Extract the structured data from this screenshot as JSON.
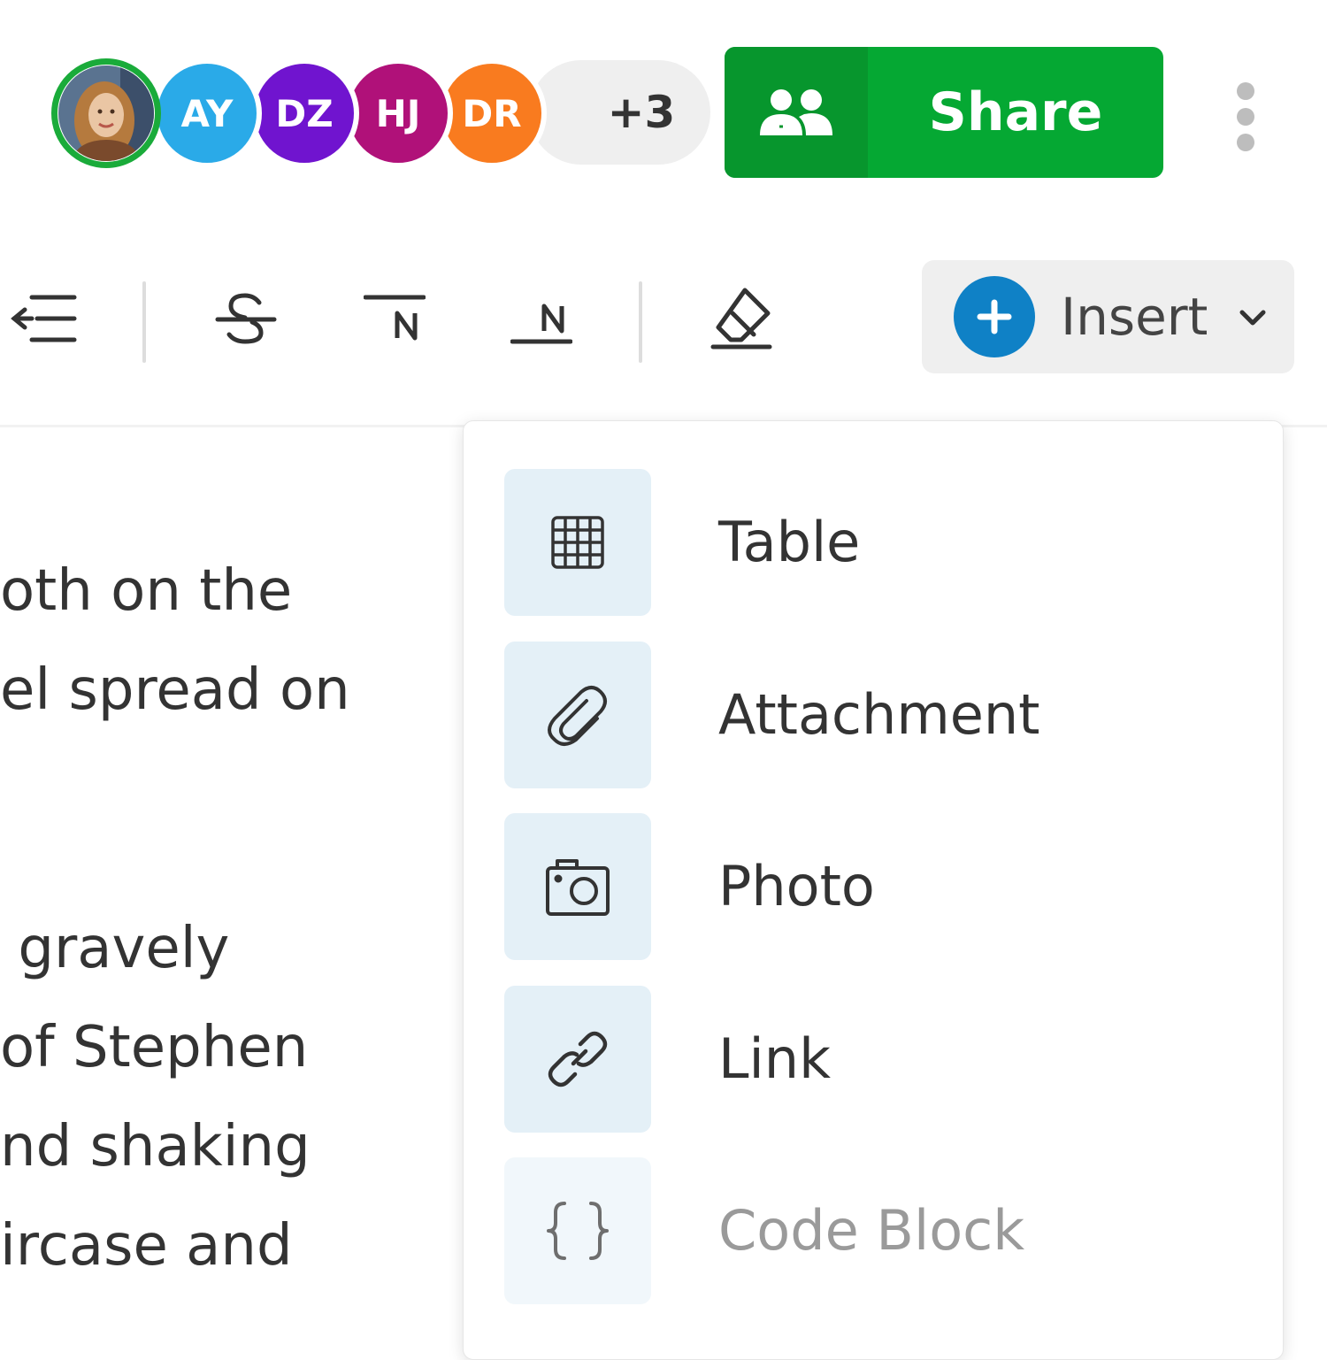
{
  "collaborators": {
    "avatars": [
      {
        "initials": "",
        "kind": "photo",
        "color": "#1aab3a"
      },
      {
        "initials": "AY",
        "color": "#2aaae8"
      },
      {
        "initials": "DZ",
        "color": "#7014cf"
      },
      {
        "initials": "HJ",
        "color": "#b01179"
      },
      {
        "initials": "DR",
        "color": "#f97b1f"
      }
    ],
    "more_count": "+3"
  },
  "share_button": {
    "label": "Share",
    "icon": "people-icon",
    "color": "#05a833"
  },
  "overflow_menu": {
    "icon": "vertical-ellipsis-icon"
  },
  "toolbar": {
    "buttons": [
      {
        "name": "outdent",
        "icon": "outdent-icon"
      },
      {
        "name": "strikethrough",
        "icon": "strikethrough-icon"
      },
      {
        "name": "superscript",
        "icon": "superscript-icon"
      },
      {
        "name": "subscript",
        "icon": "subscript-icon"
      },
      {
        "name": "clear-formatting",
        "icon": "eraser-icon"
      }
    ],
    "insert": {
      "label": "Insert",
      "icon": "plus-circle-icon",
      "accent": "#0f81c6"
    }
  },
  "document": {
    "lines": [
      "oth on the",
      "el spread on",
      "",
      "",
      " gravely",
      "of Stephen",
      "nd shaking",
      "ircase and"
    ]
  },
  "insert_menu": {
    "items": [
      {
        "label": "Table",
        "icon": "table-icon",
        "disabled": false
      },
      {
        "label": "Attachment",
        "icon": "paperclip-icon",
        "disabled": false
      },
      {
        "label": "Photo",
        "icon": "camera-icon",
        "disabled": false
      },
      {
        "label": "Link",
        "icon": "link-icon",
        "disabled": false
      },
      {
        "label": "Code Block",
        "icon": "code-braces-icon",
        "disabled": true
      }
    ]
  }
}
